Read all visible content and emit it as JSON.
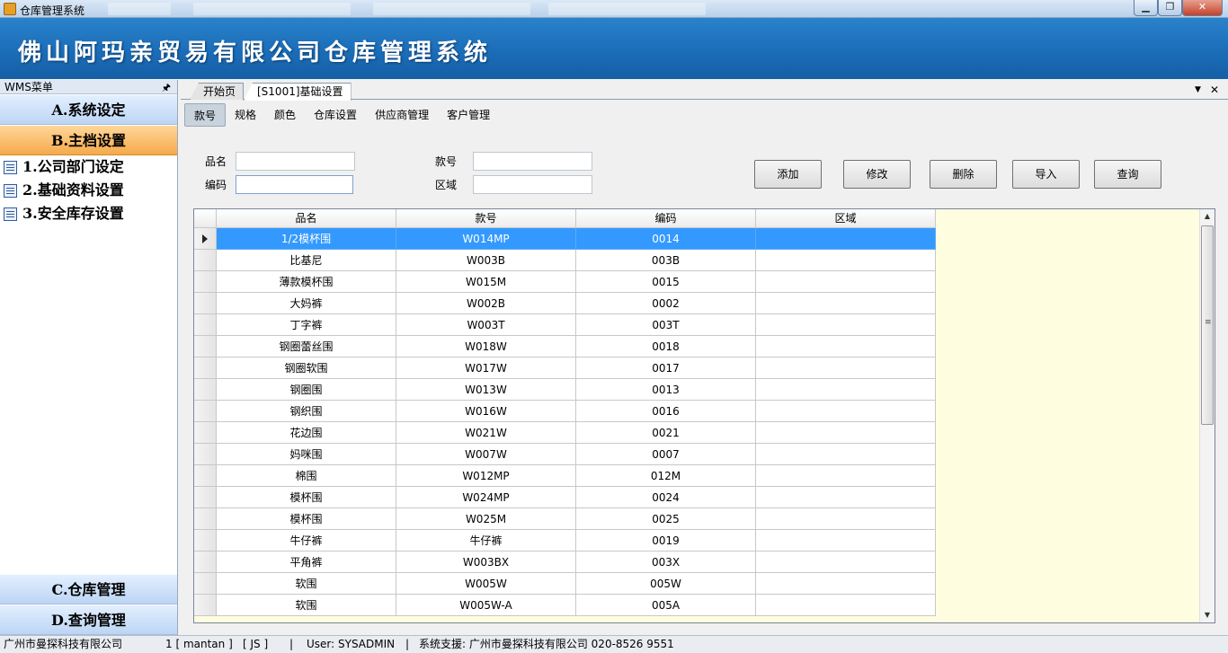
{
  "window": {
    "title": "仓库管理系统",
    "min_label": "▁",
    "max_label": "❐",
    "close_label": "✕"
  },
  "banner": {
    "title": "佛山阿玛亲贸易有限公司仓库管理系统"
  },
  "left_panel": {
    "title": "WMS菜单",
    "pin_icon": "📌",
    "groups_top": [
      {
        "label": "A.系统设定"
      },
      {
        "label": "B.主档设置"
      }
    ],
    "items": [
      {
        "label": "1.公司部门设定"
      },
      {
        "label": "2.基础资料设置"
      },
      {
        "label": "3.安全库存设置"
      }
    ],
    "groups_bottom": [
      {
        "label": "C.仓库管理"
      },
      {
        "label": "D.查询管理"
      }
    ]
  },
  "doc_tabs": [
    {
      "label": "开始页"
    },
    {
      "label": "[S1001]基础设置"
    }
  ],
  "sub_tabs": [
    {
      "label": "款号"
    },
    {
      "label": "规格"
    },
    {
      "label": "颜色"
    },
    {
      "label": "仓库设置"
    },
    {
      "label": "供应商管理"
    },
    {
      "label": "客户管理"
    }
  ],
  "filters": {
    "name_label": "品名",
    "code_label": "编码",
    "style_label": "款号",
    "area_label": "区域",
    "name_value": "",
    "code_value": "",
    "style_value": "",
    "area_value": ""
  },
  "buttons": {
    "add": "添加",
    "edit": "修改",
    "delete": "删除",
    "import": "导入",
    "query": "查询"
  },
  "grid": {
    "columns": [
      "品名",
      "款号",
      "编码",
      "区域"
    ],
    "rows": [
      [
        "1/2模杯围",
        "W014MP",
        "0014",
        ""
      ],
      [
        "比基尼",
        "W003B",
        "003B",
        ""
      ],
      [
        "薄款模杯围",
        "W015M",
        "0015",
        ""
      ],
      [
        "大妈裤",
        "W002B",
        "0002",
        ""
      ],
      [
        "丁字裤",
        "W003T",
        "003T",
        ""
      ],
      [
        "钢圈蕾丝围",
        "W018W",
        "0018",
        ""
      ],
      [
        "钢圈软围",
        "W017W",
        "0017",
        ""
      ],
      [
        "钢圈围",
        "W013W",
        "0013",
        ""
      ],
      [
        "钢织围",
        "W016W",
        "0016",
        ""
      ],
      [
        "花边围",
        "W021W",
        "0021",
        ""
      ],
      [
        "妈咪围",
        "W007W",
        "0007",
        ""
      ],
      [
        "棉围",
        "W012MP",
        "012M",
        ""
      ],
      [
        "模杯围",
        "W024MP",
        "0024",
        ""
      ],
      [
        "模杯围",
        "W025M",
        "0025",
        ""
      ],
      [
        "牛仔裤",
        "牛仔裤",
        "0019",
        ""
      ],
      [
        "平角裤",
        "W003BX",
        "003X",
        ""
      ],
      [
        "软围",
        "W005W",
        "005W",
        ""
      ],
      [
        "软围",
        "W005W-A",
        "005A",
        ""
      ]
    ],
    "selected_row": 0
  },
  "status_bar": {
    "company": "广州市曼探科技有限公司",
    "session": "1 [ mantan ]",
    "js": "[ JS ]",
    "sep1": "|",
    "user": "User: SYSADMIN",
    "sep2": "|",
    "support": "系统支援: 广州市曼探科技有限公司 020-8526 9551"
  }
}
